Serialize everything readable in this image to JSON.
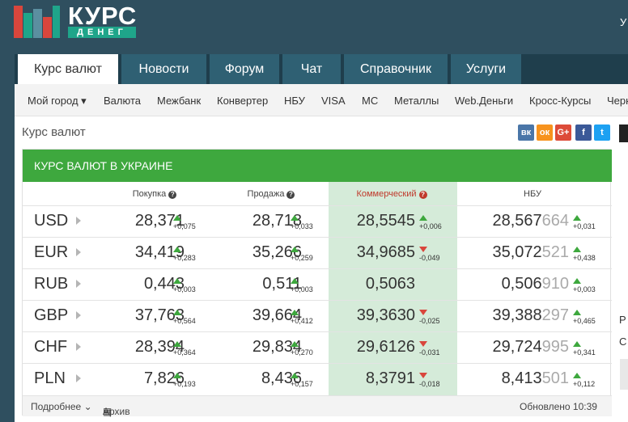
{
  "brand": {
    "title": "КУРС",
    "subtitle": "ДЕНЕГ",
    "bar_colors": [
      "#d9463c",
      "#1fa58a",
      "#5b8fa0",
      "#d9463c",
      "#1fa58a"
    ]
  },
  "header": {
    "corner_text": "У"
  },
  "tabs": [
    {
      "label": "Курс валют",
      "active": true
    },
    {
      "label": "Новости"
    },
    {
      "label": "Форум"
    },
    {
      "label": "Чат"
    },
    {
      "label": "Справочник"
    },
    {
      "label": "Услуги"
    }
  ],
  "subnav": [
    {
      "label": "Мой город ▾"
    },
    {
      "label": "Валюта"
    },
    {
      "label": "Межбанк"
    },
    {
      "label": "Конвертер"
    },
    {
      "label": "НБУ"
    },
    {
      "label": "VISA"
    },
    {
      "label": "MC"
    },
    {
      "label": "Металлы"
    },
    {
      "label": "Web.Деньги"
    },
    {
      "label": "Кросс-Курсы"
    },
    {
      "label": "Черн"
    }
  ],
  "page": {
    "title": "Курс валют"
  },
  "social": [
    {
      "name": "vk-icon",
      "glyph": "вк",
      "color": "#4a76a8"
    },
    {
      "name": "odnoklassniki-icon",
      "glyph": "ок",
      "color": "#f7931e"
    },
    {
      "name": "google-plus-icon",
      "glyph": "G+",
      "color": "#dd4b39"
    },
    {
      "name": "facebook-icon",
      "glyph": "f",
      "color": "#3b5998"
    },
    {
      "name": "twitter-icon",
      "glyph": "t",
      "color": "#1da1f2"
    }
  ],
  "table": {
    "heading": "КУРС ВАЛЮТ В УКРАИНЕ",
    "columns": {
      "buy": "Покупка",
      "sell": "Продажа",
      "commercial": "Коммерческий",
      "nbu": "НБУ"
    },
    "rows": [
      {
        "currency": "USD",
        "buy": "28,371",
        "buy_change": "+0,075",
        "buy_dir": "up",
        "sell": "28,718",
        "sell_change": "+0,033",
        "sell_dir": "up",
        "comm": "28,5545",
        "comm_change": "+0,006",
        "comm_dir": "up",
        "nbu_main": "28,567",
        "nbu_extra": "664",
        "nbu_change": "+0,031",
        "nbu_dir": "up"
      },
      {
        "currency": "EUR",
        "buy": "34,419",
        "buy_change": "+0,283",
        "buy_dir": "up",
        "sell": "35,266",
        "sell_change": "+0,259",
        "sell_dir": "up",
        "comm": "34,9685",
        "comm_change": "-0,049",
        "comm_dir": "down",
        "nbu_main": "35,072",
        "nbu_extra": "521",
        "nbu_change": "+0,438",
        "nbu_dir": "up"
      },
      {
        "currency": "RUB",
        "buy": "0,443",
        "buy_change": "+0,003",
        "buy_dir": "up",
        "sell": "0,511",
        "sell_change": "+0,003",
        "sell_dir": "up",
        "comm": "0,5063",
        "comm_change": "",
        "comm_dir": "",
        "nbu_main": "0,506",
        "nbu_extra": "910",
        "nbu_change": "+0,003",
        "nbu_dir": "up"
      },
      {
        "currency": "GBP",
        "buy": "37,763",
        "buy_change": "+0,564",
        "buy_dir": "up",
        "sell": "39,664",
        "sell_change": "+0,412",
        "sell_dir": "up",
        "comm": "39,3630",
        "comm_change": "-0,025",
        "comm_dir": "down",
        "nbu_main": "39,388",
        "nbu_extra": "297",
        "nbu_change": "+0,465",
        "nbu_dir": "up"
      },
      {
        "currency": "CHF",
        "buy": "28,394",
        "buy_change": "+0,364",
        "buy_dir": "up",
        "sell": "29,834",
        "sell_change": "+0,270",
        "sell_dir": "up",
        "comm": "29,6126",
        "comm_change": "-0,031",
        "comm_dir": "down",
        "nbu_main": "29,724",
        "nbu_extra": "995",
        "nbu_change": "+0,341",
        "nbu_dir": "up"
      },
      {
        "currency": "PLN",
        "buy": "7,826",
        "buy_change": "+0,193",
        "buy_dir": "up",
        "sell": "8,436",
        "sell_change": "+0,157",
        "sell_dir": "up",
        "comm": "8,3791",
        "comm_change": "-0,018",
        "comm_dir": "down",
        "nbu_main": "8,413",
        "nbu_extra": "501",
        "nbu_change": "+0,112",
        "nbu_dir": "up"
      }
    ]
  },
  "footer": {
    "more": "Подробнее ⌄",
    "archive": "Архив",
    "updated": "Обновлено 10:39"
  },
  "right_fragments": [
    "Р",
    "С"
  ]
}
